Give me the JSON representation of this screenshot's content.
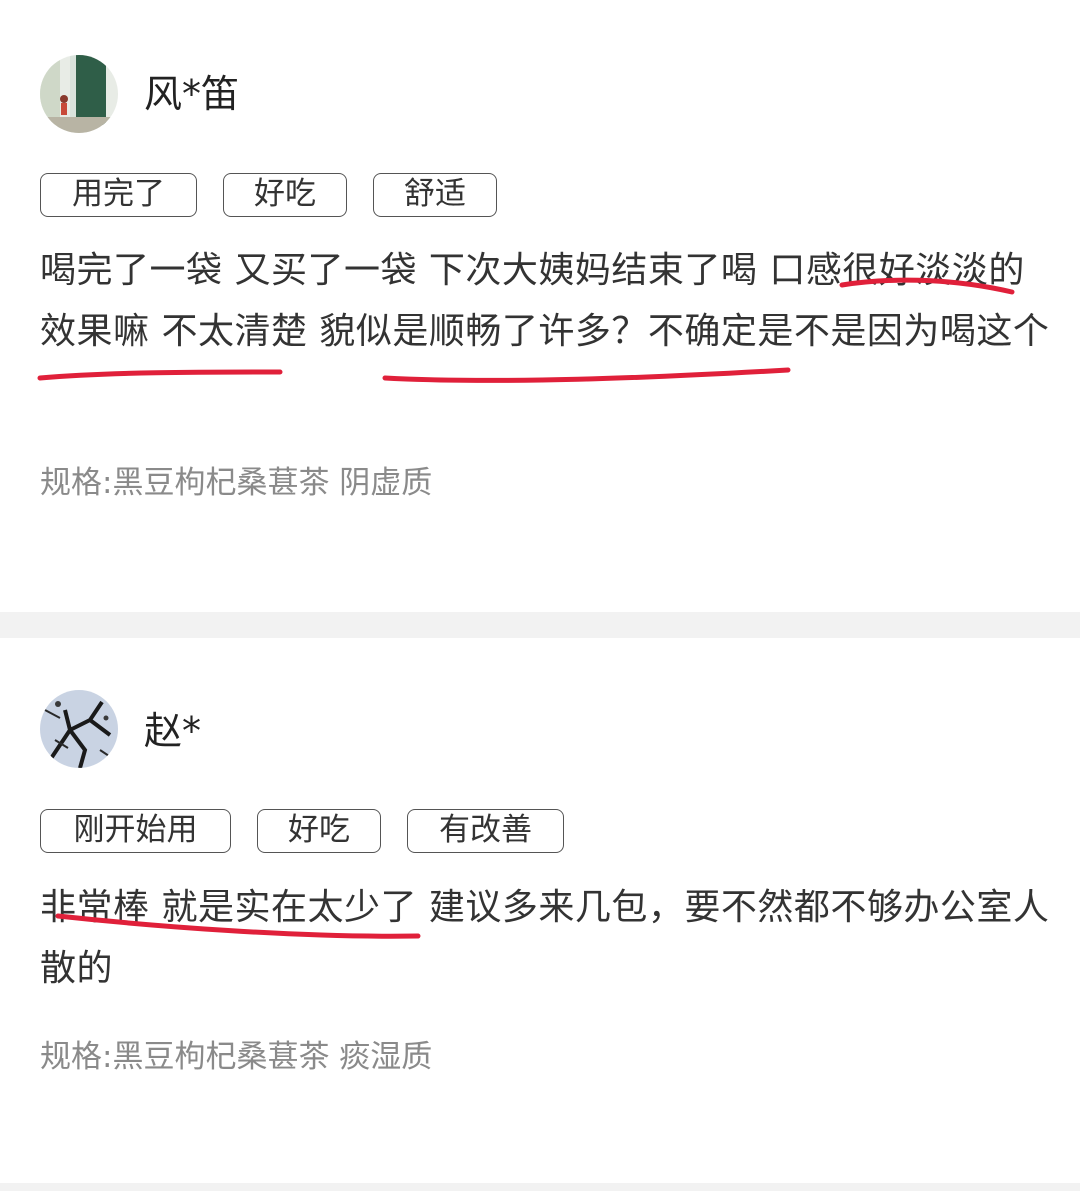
{
  "reviews": [
    {
      "username": "风*笛",
      "avatar_icon": "avatar-image",
      "tags": [
        "用完了",
        "好吃",
        "舒适"
      ],
      "content": "喝完了一袋 又买了一袋 下次大姨妈结束了喝 口感很好淡淡的 效果嘛 不太清楚 貌似是顺畅了许多？不确定是不是因为喝这个",
      "spec": "规格:黑豆枸杞桑葚茶 阴虚质"
    },
    {
      "username": "赵*",
      "avatar_icon": "avatar-image",
      "tags": [
        "刚开始用",
        "好吃",
        "有改善"
      ],
      "content": "非常棒 就是实在太少了 建议多来几包，要不然都不够办公室人散的",
      "spec": "规格:黑豆枸杞桑葚茶 痰湿质"
    }
  ],
  "colors": {
    "marker": "#e0203a",
    "spec_text": "#8a8a8a",
    "separator": "#f2f2f2"
  }
}
